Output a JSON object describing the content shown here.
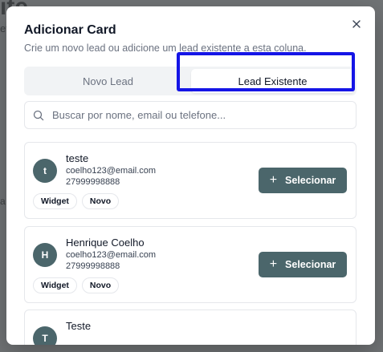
{
  "background": {
    "title_fragment": "ite",
    "subtitle_fragment": "ef",
    "side_fragment": "a"
  },
  "dialog": {
    "title": "Adicionar Card",
    "subtitle": "Crie um novo lead ou adicione um lead existente a esta coluna.",
    "close_icon": "close-icon"
  },
  "tabs": [
    {
      "label": "Novo Lead",
      "active": false
    },
    {
      "label": "Lead Existente",
      "active": true
    }
  ],
  "search": {
    "placeholder": "Buscar por nome, email ou telefone...",
    "value": ""
  },
  "leads": [
    {
      "initial": "t",
      "name": "teste",
      "email": "coelho123@email.com",
      "phone": "27999998888",
      "tags": [
        "Widget",
        "Novo"
      ],
      "action_label": "Selecionar"
    },
    {
      "initial": "H",
      "name": "Henrique Coelho",
      "email": "coelho123@email.com",
      "phone": "27999998888",
      "tags": [
        "Widget",
        "Novo"
      ],
      "action_label": "Selecionar"
    },
    {
      "initial": "T",
      "name": "Teste"
    }
  ],
  "colors": {
    "accent": "#4b666b",
    "highlight": "#1515e6"
  }
}
